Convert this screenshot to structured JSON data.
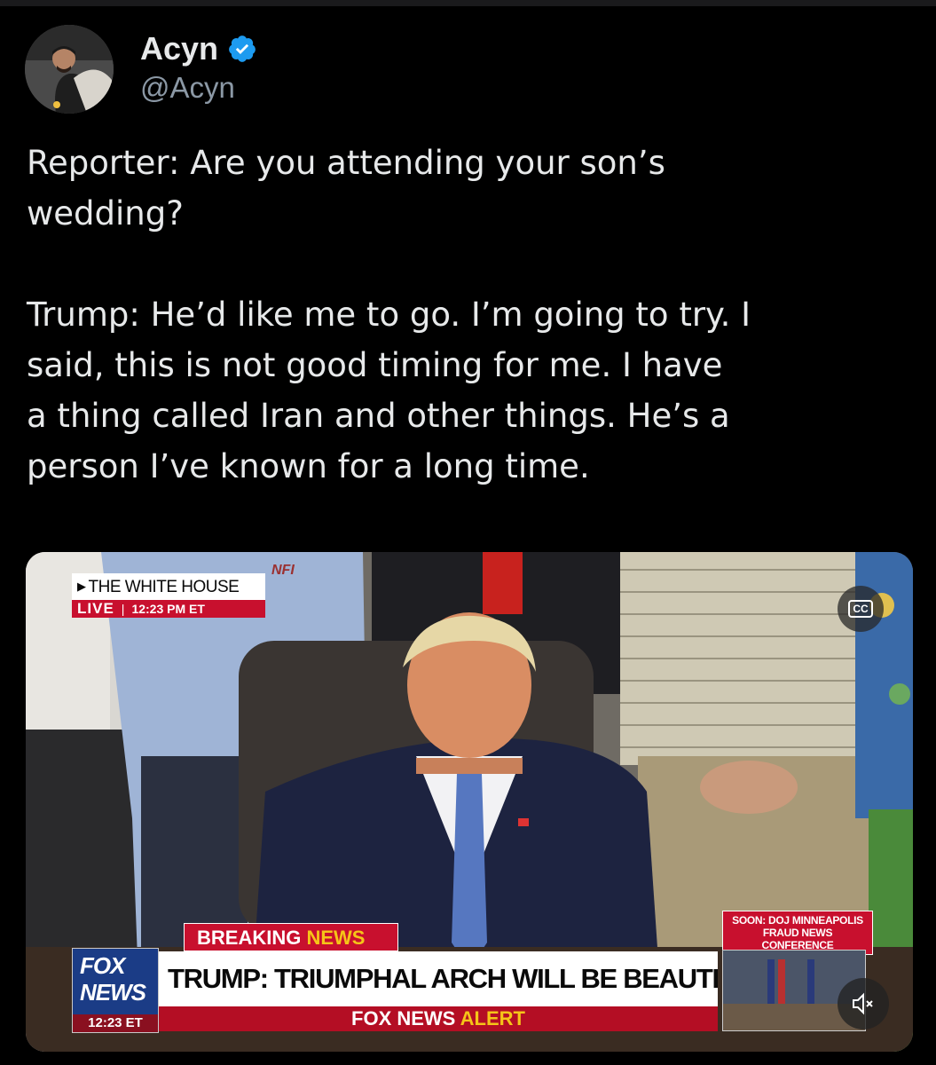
{
  "author": {
    "name": "Acyn",
    "handle": "@Acyn",
    "verified": true,
    "verified_color": "#1d9bf0",
    "avatar_icon": "profile-photo"
  },
  "tweet": {
    "text": "Reporter: Are you attending your son’s\nwedding?\n\nTrump: He’d like me to go. I’m going to try. I\nsaid, this is not good timing for me. I have\na thing called Iran and other things. He’s a\nperson I’ve known for a long time."
  },
  "video": {
    "location": "THE WHITE HOUSE",
    "live": "LIVE",
    "location_time": "12:23 PM ET",
    "cap_logo": "NFI",
    "breaking_1": "BREAKING",
    "breaking_2": "NEWS",
    "headline": "TRUMP: TRIUMPHAL ARCH WILL BE BEAUTIFUL",
    "alert_1": "FOX NEWS",
    "alert_2": "ALERT",
    "logo_line1": "FOX",
    "logo_line2": "NEWS",
    "logo_time": "12:23 ET",
    "soon_line1": "SOON: DOJ MINNEAPOLIS",
    "soon_line2": "FRAUD NEWS CONFERENCE",
    "cc_label": "CC",
    "cc_icon": "closed-captions-icon",
    "mute_icon": "speaker-muted-icon",
    "colors": {
      "fox_red": "#c8102e",
      "fox_blue": "#1b3c86",
      "fox_yellow": "#f5c518"
    }
  }
}
